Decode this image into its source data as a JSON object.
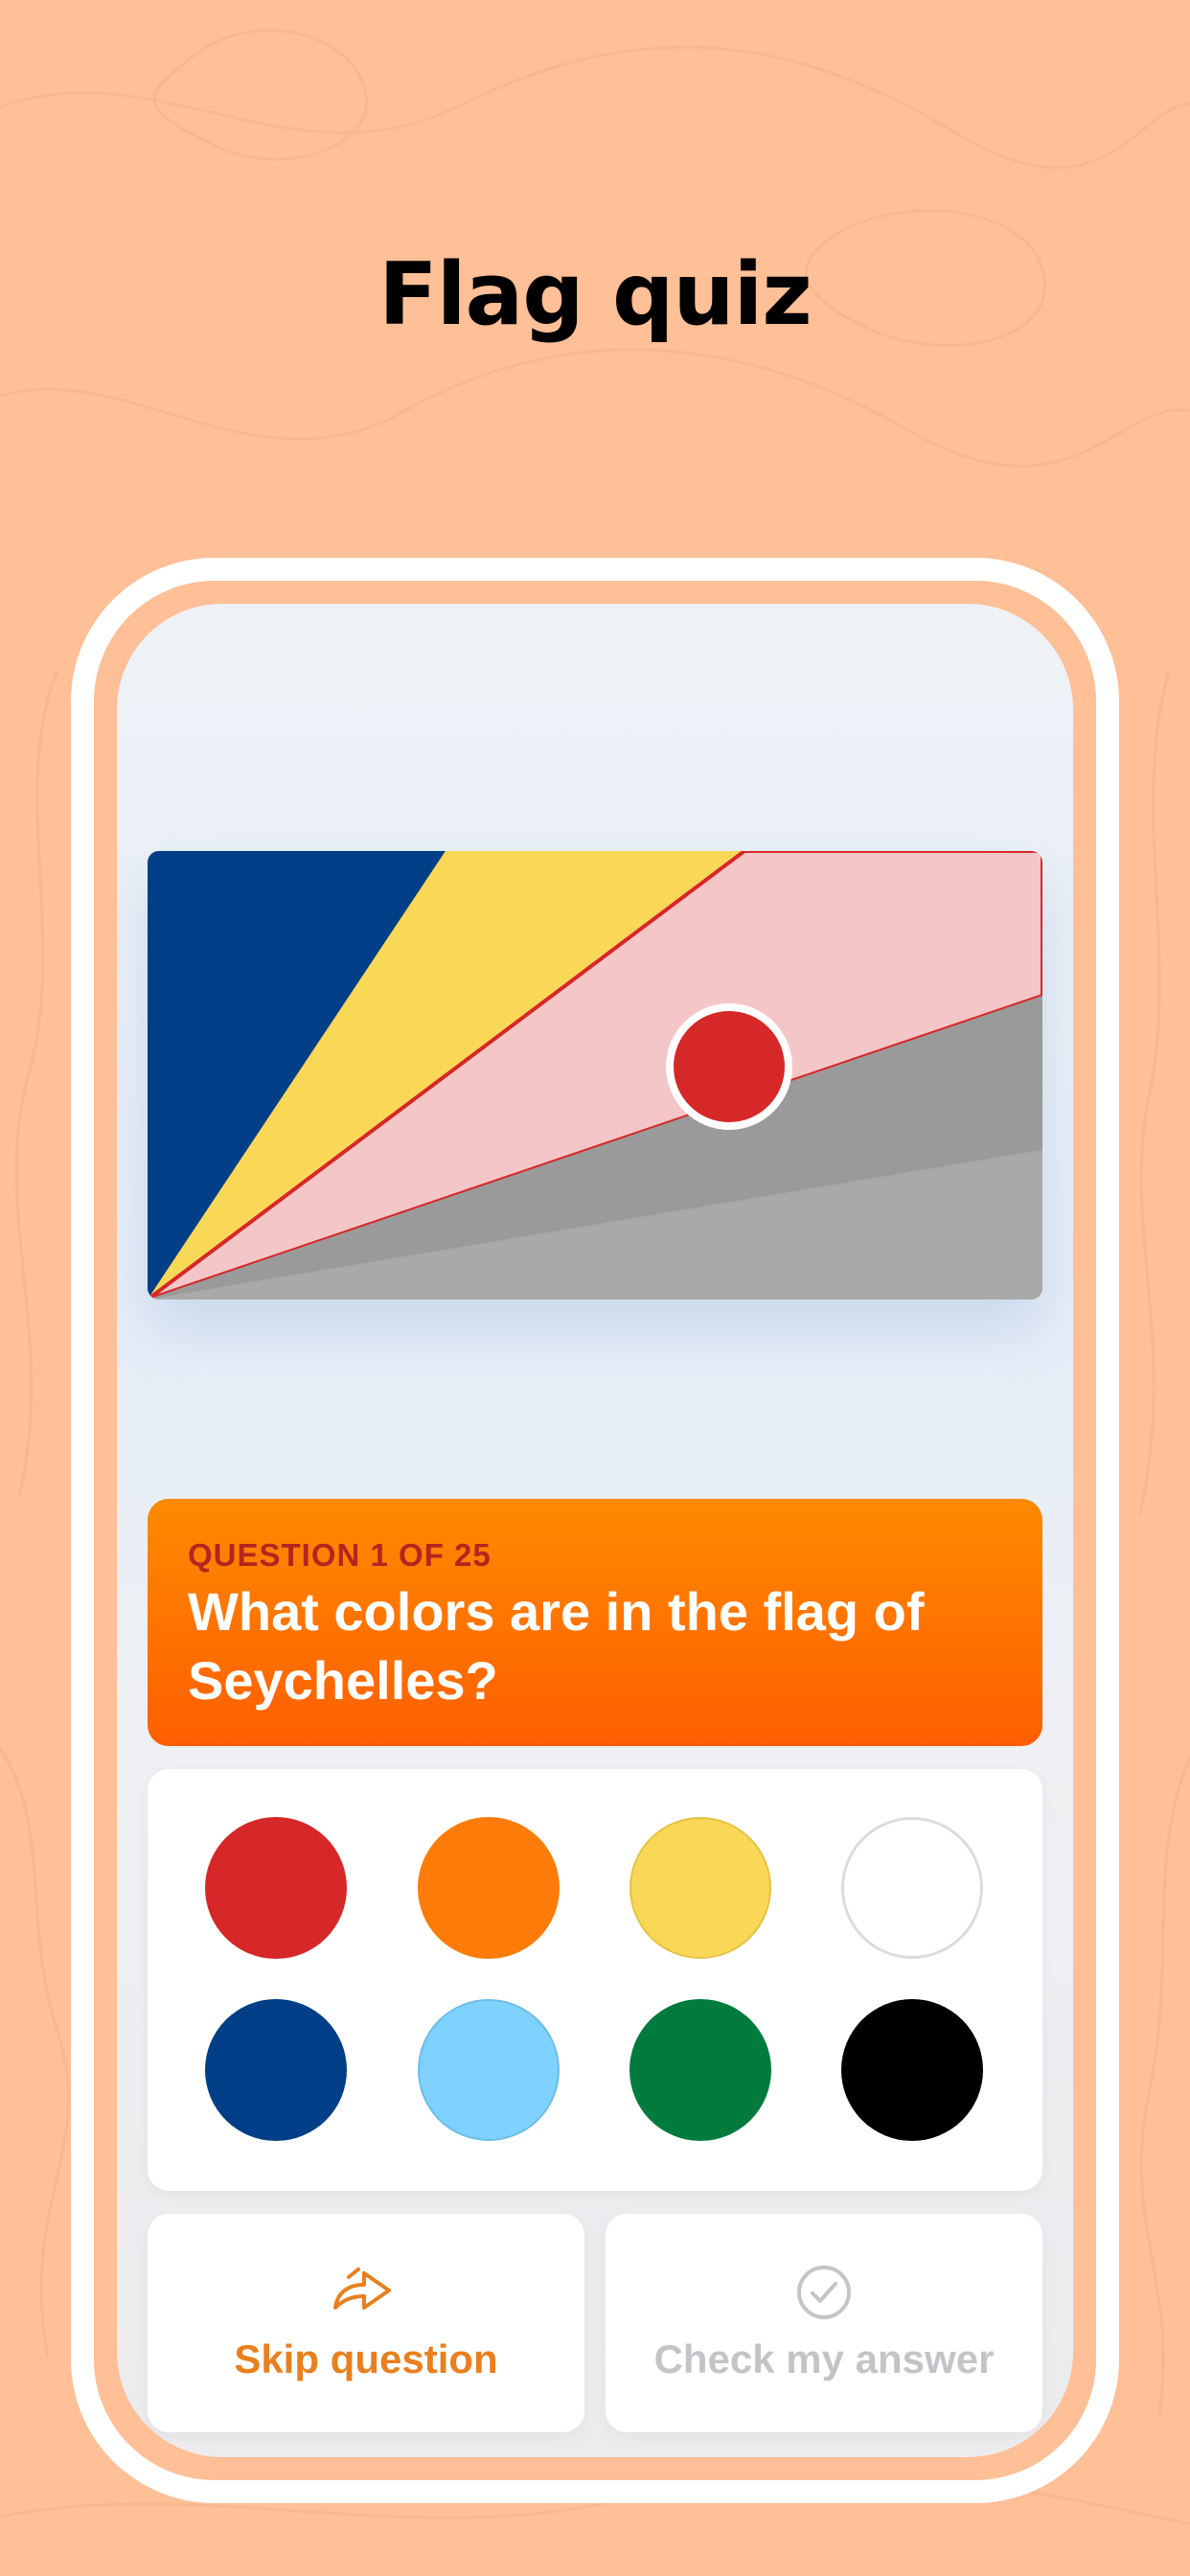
{
  "page": {
    "title": "Flag quiz",
    "background_color": "#ffbf97"
  },
  "flag": {
    "colors": [
      "#003f87",
      "#fcd856",
      "#d62828",
      "#ffffff",
      "#007a3d"
    ],
    "display_state": "partially-colored"
  },
  "question": {
    "counter": "QUESTION 1 OF 25",
    "text": "What colors are in the flag of Seychelles?"
  },
  "palette": {
    "swatches": [
      {
        "name": "red",
        "hex": "#d62828"
      },
      {
        "name": "orange",
        "hex": "#ff7c0a"
      },
      {
        "name": "yellow",
        "hex": "#fad857"
      },
      {
        "name": "white",
        "hex": "#ffffff"
      },
      {
        "name": "blue",
        "hex": "#003f87"
      },
      {
        "name": "light-blue",
        "hex": "#7fd1ff"
      },
      {
        "name": "green",
        "hex": "#007a3d"
      },
      {
        "name": "black",
        "hex": "#000000"
      }
    ]
  },
  "actions": {
    "skip_label": "Skip question",
    "skip_icon": "share-arrow-icon",
    "skip_color": "#e8801f",
    "check_label": "Check my answer",
    "check_icon": "checkmark-circle-icon",
    "check_color": "#c4c4c8"
  }
}
